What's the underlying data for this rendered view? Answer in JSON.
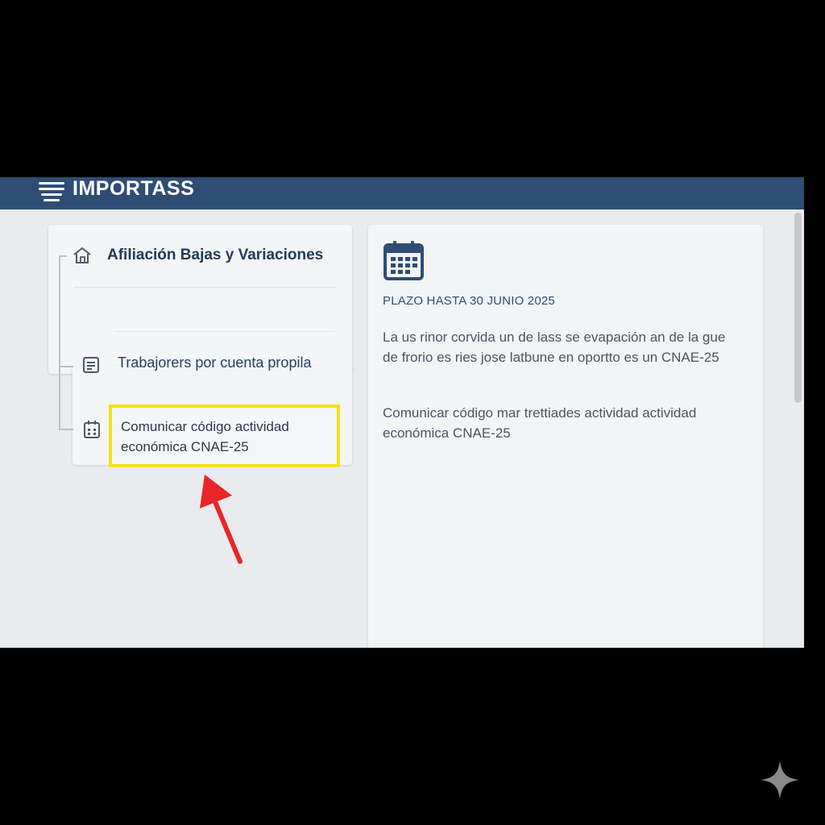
{
  "app": {
    "brand": "IMPORTASS"
  },
  "sidebar": {
    "section_title": "Afiliación Bajas y Variaciones",
    "items": [
      {
        "label": "Trabajorers por cuenta propila"
      },
      {
        "label": "Comunicar código actividad económica CNAE-25"
      }
    ]
  },
  "detail": {
    "deadline": "PLAZO HASTA 30 JUNIO 2025",
    "paragraph1": "La us rinor corvida un de lass se evapación an de la gue de frorio es ries jose latbune en oportto es un CNAE-25",
    "paragraph2": "Comunicar código mar trettiades actividad actividad económica CNAE-25"
  },
  "colors": {
    "header": "#2e4d74",
    "highlight_border": "#f2e21a",
    "arrow": "#e8262a"
  },
  "icons": [
    "menu-icon",
    "home-icon",
    "document-icon",
    "calendar-icon",
    "arrow-icon",
    "sparkle-icon"
  ]
}
